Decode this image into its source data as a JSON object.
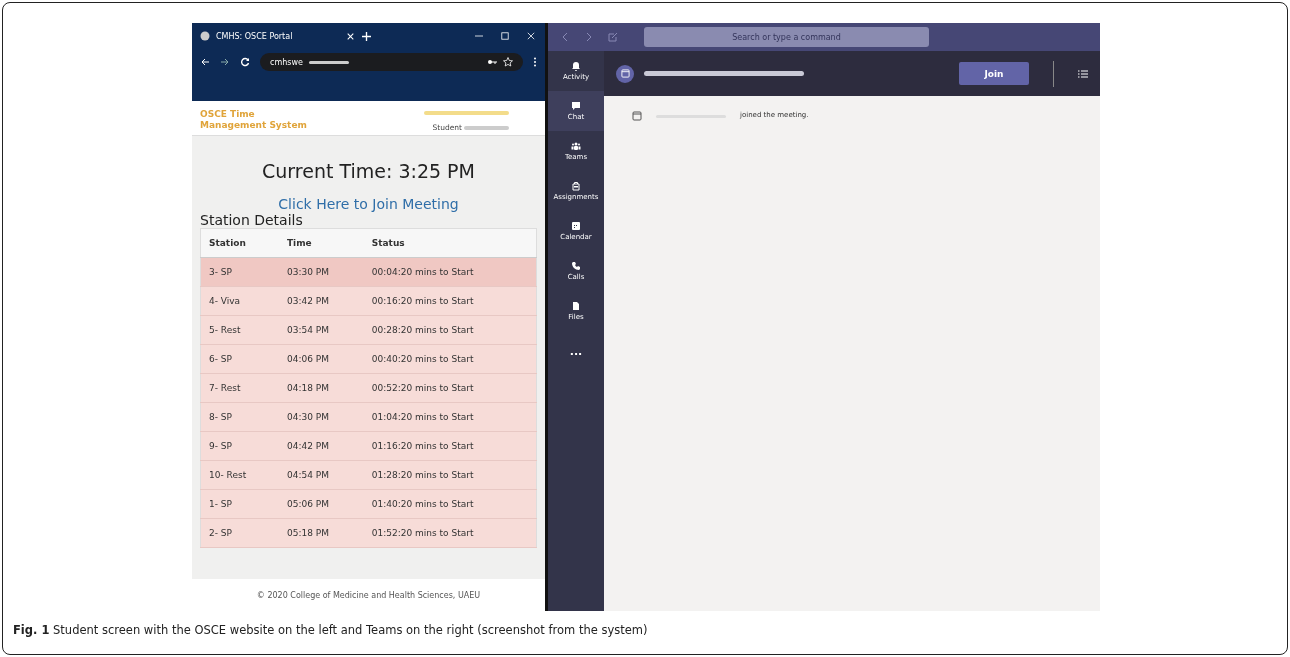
{
  "browser": {
    "tab_title": "CMHS: OSCE Portal",
    "address": "cmhswe"
  },
  "site": {
    "logo_line1": "OSCE Time",
    "logo_line2": "Management System",
    "student_label": "Student",
    "current_time": "Current Time: 3:25 PM",
    "join_link": "Click Here to Join Meeting",
    "section_title": "Station Details",
    "footer": "© 2020 College of Medicine and Health Sciences, UAEU"
  },
  "table": {
    "columns": [
      "Station",
      "Time",
      "Status"
    ],
    "rows": [
      {
        "cells": [
          "3- SP",
          "03:30 PM",
          "00:04:20 mins to Start"
        ],
        "selected": true
      },
      {
        "cells": [
          "4- Viva",
          "03:42 PM",
          "00:16:20 mins to Start"
        ],
        "selected": false
      },
      {
        "cells": [
          "5- Rest",
          "03:54 PM",
          "00:28:20 mins to Start"
        ],
        "selected": false
      },
      {
        "cells": [
          "6- SP",
          "04:06 PM",
          "00:40:20 mins to Start"
        ],
        "selected": false
      },
      {
        "cells": [
          "7- Rest",
          "04:18 PM",
          "00:52:20 mins to Start"
        ],
        "selected": false
      },
      {
        "cells": [
          "8- SP",
          "04:30 PM",
          "01:04:20 mins to Start"
        ],
        "selected": false
      },
      {
        "cells": [
          "9- SP",
          "04:42 PM",
          "01:16:20 mins to Start"
        ],
        "selected": false
      },
      {
        "cells": [
          "10- Rest",
          "04:54 PM",
          "01:28:20 mins to Start"
        ],
        "selected": false
      },
      {
        "cells": [
          "1- SP",
          "05:06 PM",
          "01:40:20 mins to Start"
        ],
        "selected": false
      },
      {
        "cells": [
          "2- SP",
          "05:18 PM",
          "01:52:20 mins to Start"
        ],
        "selected": false
      }
    ]
  },
  "teams": {
    "search": {
      "placeholder": "Search or type a command"
    },
    "join_button": "Join",
    "message": "joined the meeting.",
    "rail": [
      {
        "kind": "bell",
        "label": "Activity",
        "selected": false
      },
      {
        "kind": "chat",
        "label": "Chat",
        "selected": true
      },
      {
        "kind": "teams",
        "label": "Teams",
        "selected": false
      },
      {
        "kind": "bag",
        "label": "Assignments",
        "selected": false
      },
      {
        "kind": "calendar",
        "label": "Calendar",
        "selected": false
      },
      {
        "kind": "phone",
        "label": "Calls",
        "selected": false
      },
      {
        "kind": "file",
        "label": "Files",
        "selected": false
      },
      {
        "kind": "more",
        "label": "...",
        "selected": false
      }
    ]
  },
  "caption": {
    "text": "**Fig. 1** Student screen with the OSCE website on the left and Teams on the right (screenshot from the system)"
  }
}
